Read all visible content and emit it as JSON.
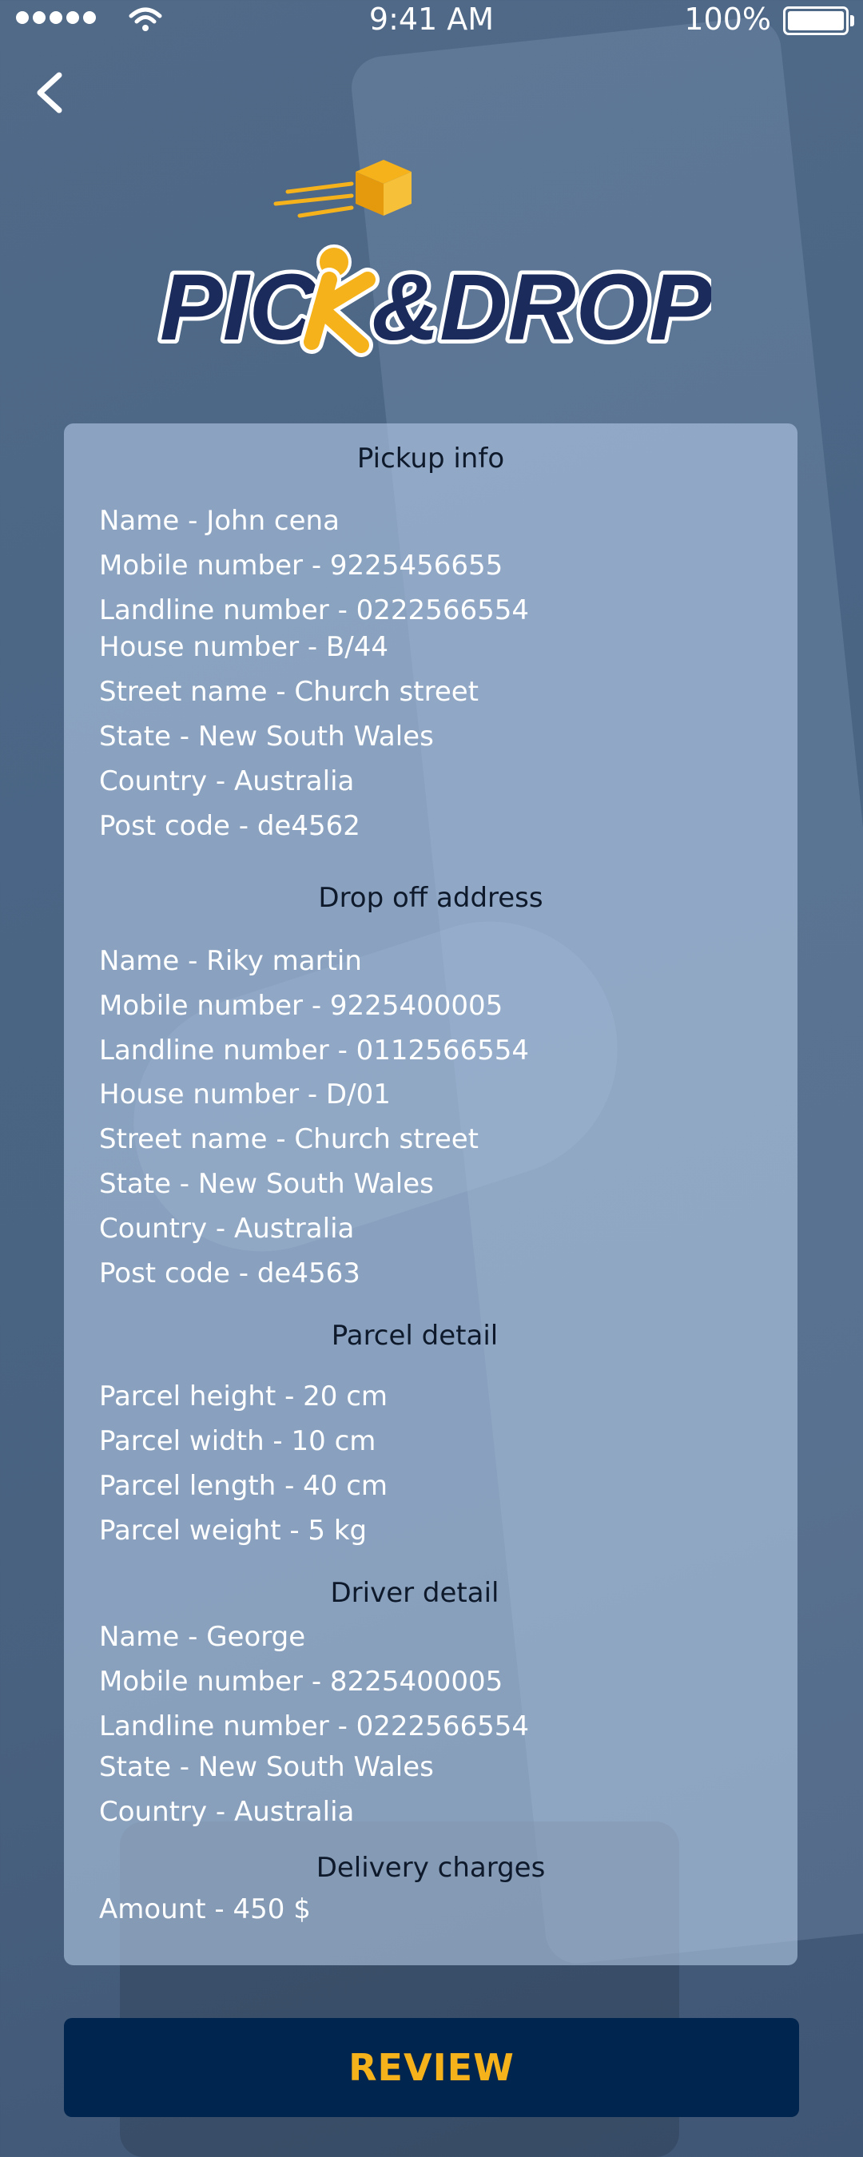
{
  "status_bar": {
    "time": "9:41 AM",
    "battery": "100%"
  },
  "logo": {
    "text": "PICK&DROP",
    "primary_color": "#1a2b5c",
    "accent_color": "#f6b21b"
  },
  "sections": {
    "pickup": {
      "title": "Pickup info",
      "lines": [
        "Name - John cena",
        "Mobile number - 9225456655",
        "Landline number - 0222566554",
        "House number - B/44",
        "Street name - Church street",
        "State - New South Wales",
        "Country - Australia",
        "Post code - de4562"
      ]
    },
    "dropoff": {
      "title": "Drop off address",
      "lines": [
        "Name - Riky martin",
        "Mobile number - 9225400005",
        "Landline number - 0112566554",
        "House number - D/01",
        "Street name - Church street",
        "State - New South Wales",
        "Country - Australia",
        "Post code - de4563"
      ]
    },
    "parcel": {
      "title": "Parcel detail",
      "lines": [
        "Parcel height - 20 cm",
        "Parcel width - 10 cm",
        "Parcel length - 40 cm",
        "Parcel weight - 5 kg"
      ]
    },
    "driver": {
      "title": "Driver detail",
      "lines": [
        "Name - George",
        "Mobile number - 8225400005",
        "Landline number - 0222566554",
        "State - New South Wales",
        "Country - Australia"
      ]
    },
    "charges": {
      "title": "Delivery charges",
      "lines": [
        "Amount - 450 $"
      ]
    }
  },
  "review_button": {
    "label": "REVIEW"
  },
  "colors": {
    "button_bg": "#00254f",
    "button_text": "#f6b21b"
  }
}
